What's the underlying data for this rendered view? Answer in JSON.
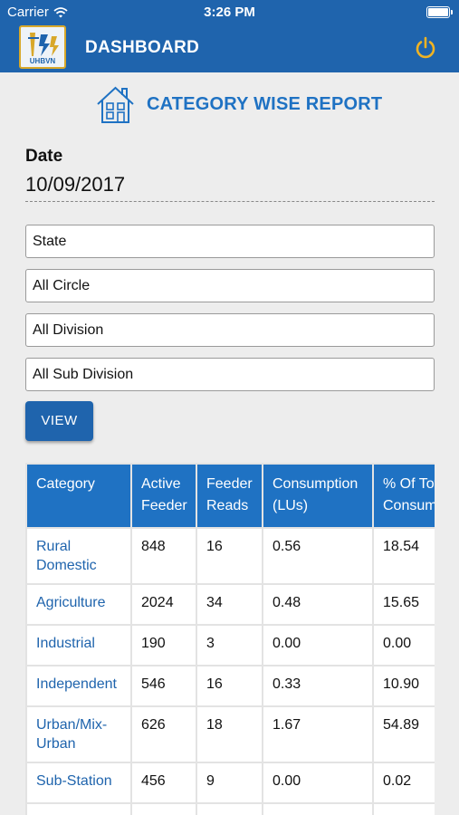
{
  "status_bar": {
    "carrier": "Carrier",
    "time": "3:26 PM"
  },
  "header": {
    "title": "DASHBOARD",
    "logo_text": "UHBVN"
  },
  "report": {
    "title": "CATEGORY WISE REPORT"
  },
  "date": {
    "label": "Date",
    "value": "10/09/2017"
  },
  "filters": {
    "state": "State",
    "circle": "All Circle",
    "division": "All Division",
    "sub_division": "All Sub Division"
  },
  "view_button": "VIEW",
  "table": {
    "headers": {
      "category": "Category",
      "active_feeder_1": "Active",
      "active_feeder_2": "Feeder",
      "feeder_reads_1": "Feeder",
      "feeder_reads_2": "Reads",
      "consumption_1": "Consumption",
      "consumption_2": "(LUs)",
      "pct_1": "% Of Total",
      "pct_2": "Consumption"
    },
    "rows": [
      {
        "category_1": "Rural",
        "category_2": "Domestic",
        "active_feeder": "848",
        "feeder_reads": "16",
        "consumption": "0.56",
        "pct": "18.54"
      },
      {
        "category": "Agriculture",
        "active_feeder": "2024",
        "feeder_reads": "34",
        "consumption": "0.48",
        "pct": "15.65"
      },
      {
        "category": "Industrial",
        "active_feeder": "190",
        "feeder_reads": "3",
        "consumption": "0.00",
        "pct": "0.00"
      },
      {
        "category": "Independent",
        "active_feeder": "546",
        "feeder_reads": "16",
        "consumption": "0.33",
        "pct": "10.90"
      },
      {
        "category_1": "Urban/Mix-",
        "category_2": "Urban",
        "active_feeder": "626",
        "feeder_reads": "18",
        "consumption": "1.67",
        "pct": "54.89"
      },
      {
        "category": "Sub-Station",
        "active_feeder": "456",
        "feeder_reads": "9",
        "consumption": "0.00",
        "pct": "0.02"
      }
    ]
  },
  "colors": {
    "primary": "#1f64ad",
    "accent": "#1f72c3",
    "power_icon": "#f0b323"
  }
}
